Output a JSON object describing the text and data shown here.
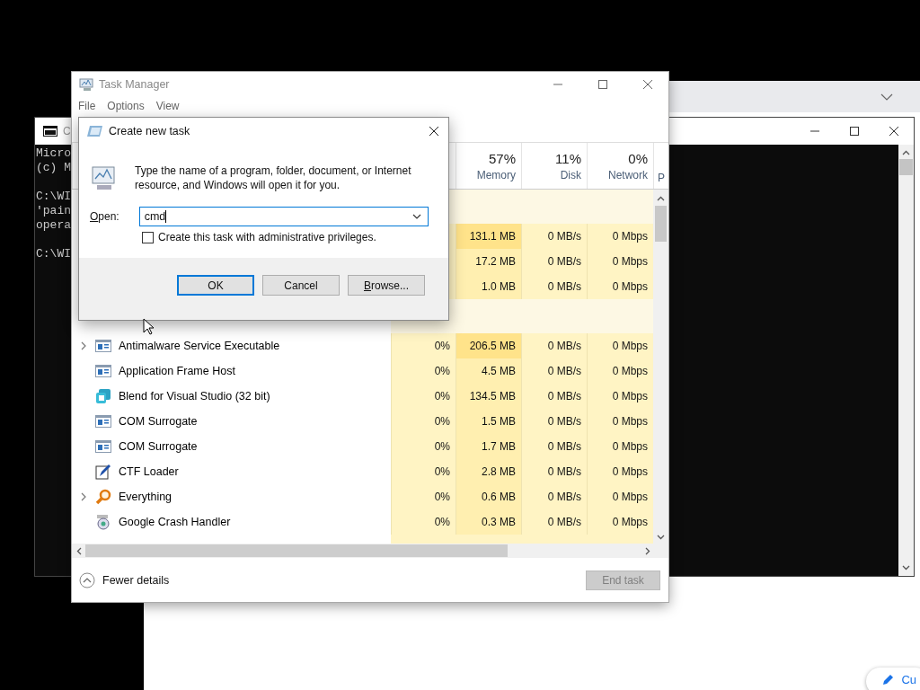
{
  "console_left": {
    "title": "C",
    "blocks": [
      [
        "Micro",
        "(c) M"
      ],
      [
        "C:\\WI",
        "'pain",
        "opera"
      ],
      [
        "C:\\WI"
      ]
    ]
  },
  "browser_window": {
    "edit_button": "Cu"
  },
  "task_manager": {
    "title": "Task Manager",
    "menu": [
      "File",
      "Options",
      "View"
    ],
    "columns": [
      {
        "percent": "57%",
        "label": "Memory"
      },
      {
        "percent": "11%",
        "label": "Disk"
      },
      {
        "percent": "0%",
        "label": "Network"
      }
    ],
    "column_5": {
      "label": "P"
    },
    "app_rows": [
      {
        "memory": "131.1 MB",
        "disk": "0 MB/s",
        "network": "0 Mbps",
        "memory_heavy": true
      },
      {
        "memory": "17.2 MB",
        "disk": "0 MB/s",
        "network": "0 Mbps",
        "memory_heavy": false
      },
      {
        "memory": "1.0 MB",
        "disk": "0 MB/s",
        "network": "0 Mbps",
        "memory_heavy": false
      }
    ],
    "background_rows": [
      {
        "name": "Antimalware Service Executable",
        "kind": "window",
        "expandable": true,
        "cpu": "0%",
        "memory": "206.5 MB",
        "disk": "0 MB/s",
        "network": "0 Mbps",
        "memory_heavy": true
      },
      {
        "name": "Application Frame Host",
        "kind": "window",
        "expandable": false,
        "cpu": "0%",
        "memory": "4.5 MB",
        "disk": "0 MB/s",
        "network": "0 Mbps",
        "memory_heavy": false
      },
      {
        "name": "Blend for Visual Studio (32 bit)",
        "kind": "blend",
        "expandable": false,
        "cpu": "0%",
        "memory": "134.5 MB",
        "disk": "0 MB/s",
        "network": "0 Mbps",
        "memory_heavy": false
      },
      {
        "name": "COM Surrogate",
        "kind": "window",
        "expandable": false,
        "cpu": "0%",
        "memory": "1.5 MB",
        "disk": "0 MB/s",
        "network": "0 Mbps",
        "memory_heavy": false
      },
      {
        "name": "COM Surrogate",
        "kind": "window",
        "expandable": false,
        "cpu": "0%",
        "memory": "1.7 MB",
        "disk": "0 MB/s",
        "network": "0 Mbps",
        "memory_heavy": false
      },
      {
        "name": "CTF Loader",
        "kind": "pen",
        "expandable": false,
        "cpu": "0%",
        "memory": "2.8 MB",
        "disk": "0 MB/s",
        "network": "0 Mbps",
        "memory_heavy": false
      },
      {
        "name": "Everything",
        "kind": "magnifier",
        "expandable": true,
        "cpu": "0%",
        "memory": "0.6 MB",
        "disk": "0 MB/s",
        "network": "0 Mbps",
        "memory_heavy": false
      },
      {
        "name": "Google Crash Handler",
        "kind": "disc",
        "expandable": false,
        "cpu": "0%",
        "memory": "0.3 MB",
        "disk": "0 MB/s",
        "network": "0 Mbps",
        "memory_heavy": false
      }
    ],
    "footer": {
      "toggle": "Fewer details",
      "end_task": {
        "label": "End task",
        "disabled": true
      }
    }
  },
  "dialog": {
    "title": "Create new task",
    "message": "Type the name of a program, folder, document, or Internet resource, and Windows will open it for you.",
    "open_label": "Open:",
    "open_label_underline_first": true,
    "value": "cmd",
    "checkbox": {
      "label": "Create this task with administrative privileges.",
      "checked": false
    },
    "buttons": [
      {
        "label": "OK",
        "default": true
      },
      {
        "label": "Cancel",
        "default": false
      },
      {
        "label": "Browse...",
        "default": false,
        "underline_first": true
      }
    ]
  }
}
